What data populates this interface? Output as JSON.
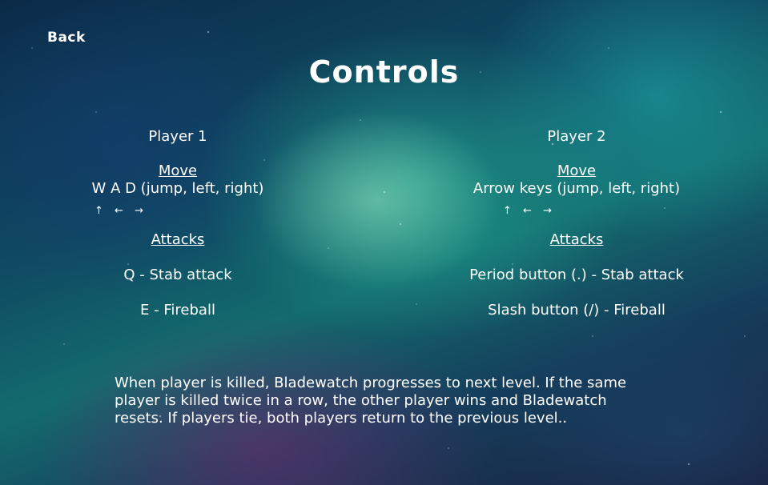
{
  "header": {
    "back_label": "Back",
    "title": "Controls"
  },
  "player1": {
    "name": "Player 1",
    "move_heading": "Move",
    "move_desc": "W A D (jump, left, right)",
    "arrow_up": "↑",
    "arrow_left": "←",
    "arrow_right": "→",
    "attacks_heading": "Attacks",
    "attack_1": "Q - Stab attack",
    "attack_2": "E - Fireball"
  },
  "player2": {
    "name": "Player 2",
    "move_heading": "Move",
    "move_desc": "Arrow keys (jump, left, right)",
    "arrow_up": "↑",
    "arrow_left": "←",
    "arrow_right": "→",
    "attacks_heading": "Attacks",
    "attack_1": "Period button (.) - Stab attack",
    "attack_2": "Slash button (/) - Fireball"
  },
  "rules": {
    "text": "When player is killed, Bladewatch progresses to next level. If the same player is killed twice in a row, the other player wins and Bladewatch resets. If players tie, both players return to the previous level.."
  },
  "colors": {
    "text": "#ffffff",
    "background_primary": "#0f4a62",
    "nebula_glow": "#28be a0"
  }
}
